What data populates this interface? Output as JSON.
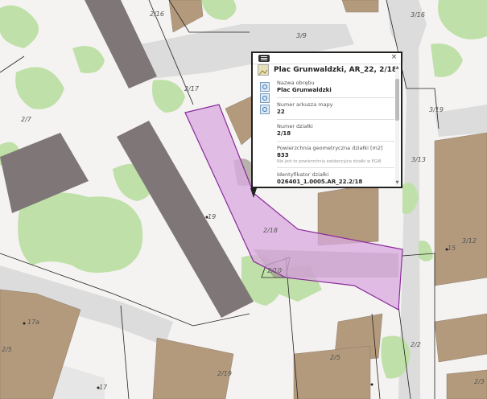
{
  "colors": {
    "background": "#f4f3f1",
    "building_brown": "#b49a7d",
    "building_gray": "#7f7777",
    "greenery": "#bfe0a8",
    "street": "#dcdcdc",
    "selected_parcel_fill": "#d9a9e0",
    "selected_parcel_stroke": "#8a2a9a"
  },
  "map_labels": {
    "l216": "2/16",
    "l39": "3/9",
    "l316": "3/16",
    "l217": "2/17",
    "l27": "2/7",
    "l319": "3/19",
    "l313": "3/13",
    "l19": "19",
    "l218": "2/18",
    "l312": "3/12",
    "l15": "15",
    "l210": "2/10",
    "l17a": "17a",
    "l25": "2/5",
    "l25b": "2/5",
    "l22": "2/2",
    "l219": "2/19",
    "l17": "17",
    "l23": "2/3"
  },
  "popup": {
    "title": "Plac Grunwaldzki, AR_22, 2/18",
    "close_label": "×",
    "header_icon": "map-thumbnail-icon",
    "tools": [
      "zoom-to-icon",
      "identify-icon",
      "print-icon"
    ],
    "fields": [
      {
        "label": "Nazwa obrębu",
        "value": "Plac Grunwaldzki"
      },
      {
        "label": "Numer arkusza mapy",
        "value": "22"
      },
      {
        "label": "Numer działki",
        "value": "2/18"
      },
      {
        "label": "Powierzchnia geometryczna działki [m2]",
        "value": "833",
        "note": "Nie jest to powierzchnia ewidencyjna działki w EGiB"
      },
      {
        "label": "Identyfikator działki",
        "value": "026401_1.0005.AR_22.2/18"
      }
    ]
  }
}
